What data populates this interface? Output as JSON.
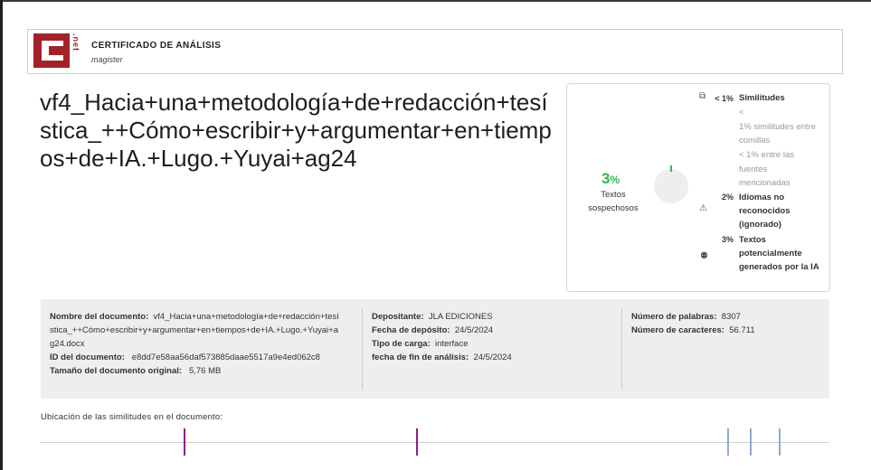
{
  "header": {
    "logo_letter": "C",
    "logo_net": ".net",
    "title": "CERTIFICADO  DE  ANÁLISIS",
    "subtitle": "magister"
  },
  "document_title": "vf4_Hacia+una+metodología+de+redacción+tesística_++Cómo+escribir+y+argumentar+en+tiempos+de+IA.+Lugo.+Yuyai+ag24",
  "summary": {
    "suspicious_value": "3",
    "suspicious_unit": "%",
    "suspicious_label": "Textos sospechosos",
    "similarities_pct": "< 1%",
    "similarities_label": "Similitudes",
    "quotes_note": "<\n1% similitudes entre comillas",
    "sources_note": "< 1% entre las fuentes mencionadas",
    "languages_pct": "2%",
    "languages_label": "Idiomas no reconocidos (ignorado)",
    "ai_pct": "3%",
    "ai_label": "Textos potencialmente generados por la IA",
    "gauge_fraction": 0.03
  },
  "details": {
    "name_label": "Nombre del documento:",
    "name_value": "vf4_Hacia+una+metodología+de+redacción+tesística_++Cómo+escribir+y+argumentar+en+tiempos+de+IA.+Lugo.+Yuyai+ag24.docx",
    "id_label": "ID del documento:",
    "id_value": "e8dd7e58aa56daf573885daae5517a9e4ed062c8",
    "size_label": "Tamaño del documento original:",
    "size_value": "5,76 MB",
    "depositor_label": "Depositante:",
    "depositor_value": "JLA EDICIONES",
    "deposit_date_label": "Fecha de depósito:",
    "deposit_date_value": "24/5/2024",
    "upload_type_label": "Tipo de carga:",
    "upload_type_value": "interface",
    "analysis_end_label": "fecha de fin de análisis:",
    "analysis_end_value": "24/5/2024",
    "words_label": "Número de palabras:",
    "words_value": "8307",
    "chars_label": "Número de caracteres:",
    "chars_value": "56.711"
  },
  "location": {
    "label": "Ubicación  de  las  similitudes  en  el  documento:",
    "markers": [
      {
        "position": 0.182,
        "color": "#8a1f86"
      },
      {
        "position": 0.476,
        "color": "#8a1f86"
      },
      {
        "position": 0.87,
        "color": "#8ea9cc"
      },
      {
        "position": 0.899,
        "color": "#8ea9cc"
      },
      {
        "position": 0.936,
        "color": "#8ea9cc"
      }
    ]
  },
  "colors": {
    "brand": "#a3222a",
    "accent_green": "#2eb84c"
  }
}
